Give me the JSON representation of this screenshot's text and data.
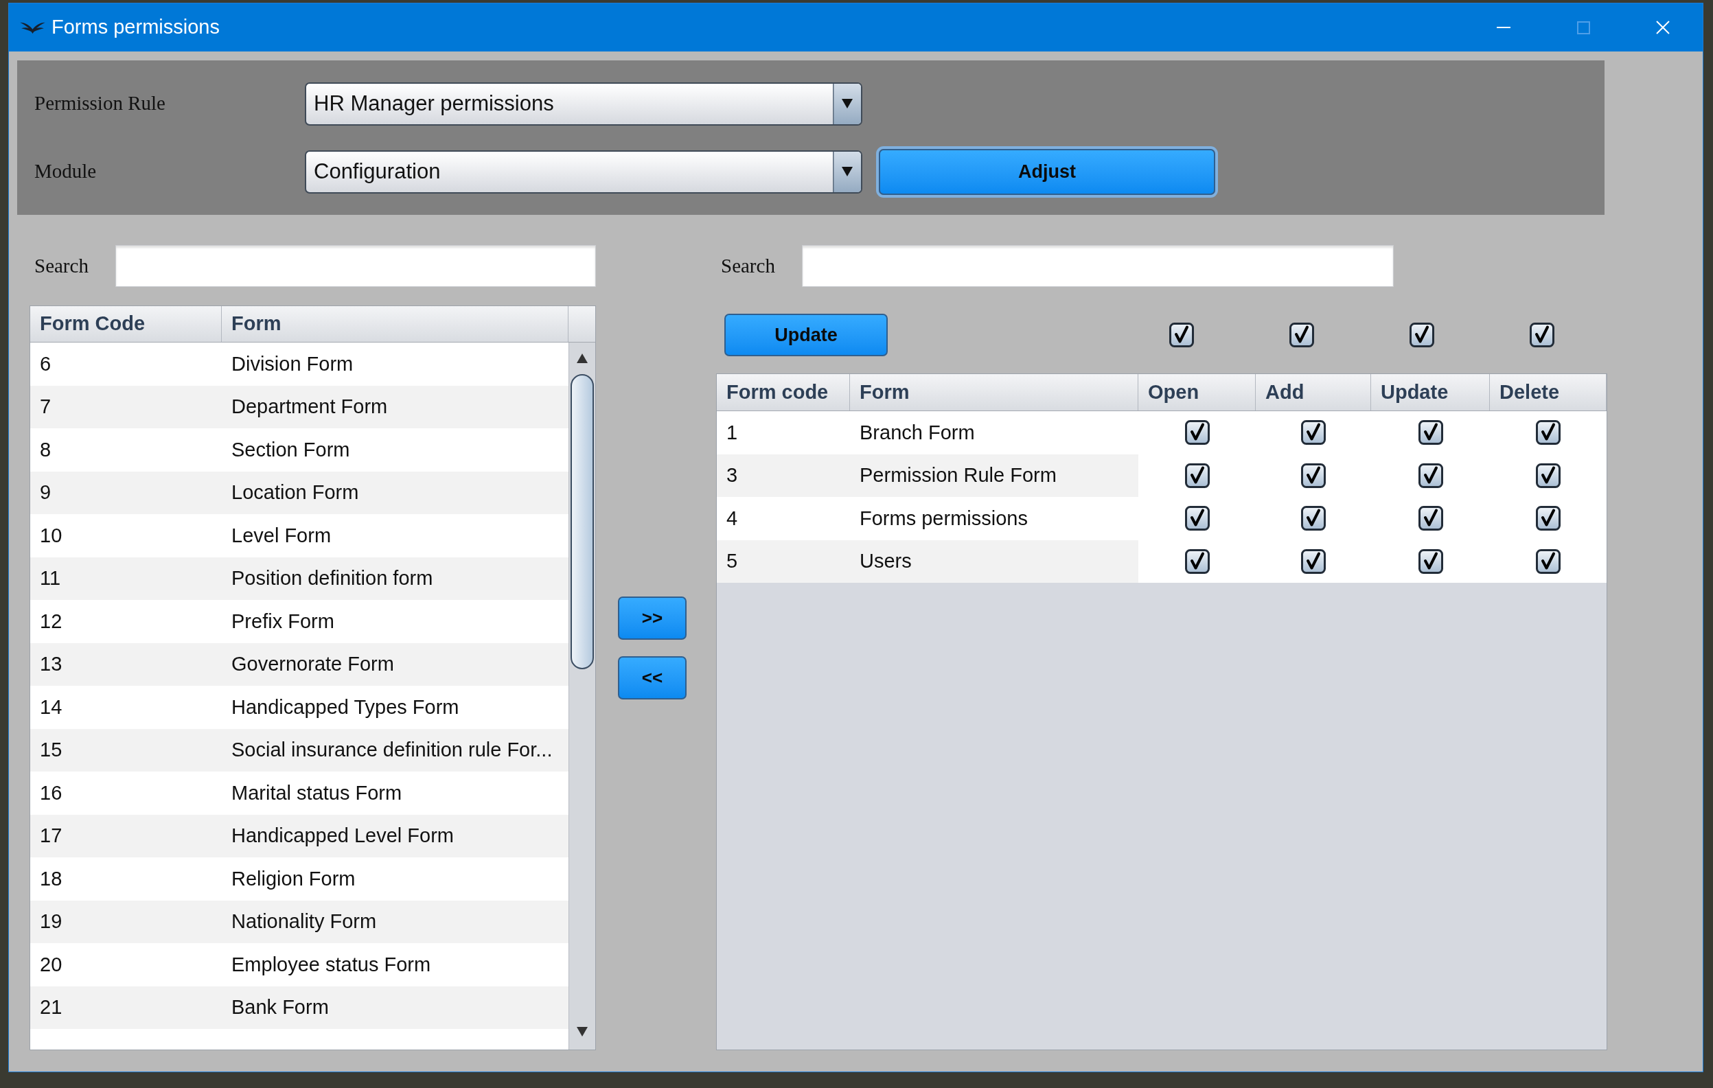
{
  "window": {
    "title": "Forms permissions",
    "controls": [
      {
        "kind": "minimize",
        "disabled": false
      },
      {
        "kind": "maximize",
        "disabled": true
      },
      {
        "kind": "close",
        "disabled": false
      }
    ]
  },
  "filter_panel": {
    "fields": [
      {
        "label": "Permission Rule",
        "value": "HR Manager permissions"
      },
      {
        "label": "Module",
        "value": "Configuration"
      }
    ],
    "adjust_button": {
      "label": "Adjust",
      "focused": true
    }
  },
  "available_forms": {
    "search": {
      "label": "Search"
    },
    "columns": [
      "Form Code",
      "Form"
    ],
    "rows": [
      {
        "code": "6",
        "form": "Division Form"
      },
      {
        "code": "7",
        "form": "Department Form"
      },
      {
        "code": "8",
        "form": "Section Form"
      },
      {
        "code": "9",
        "form": "Location Form"
      },
      {
        "code": "10",
        "form": "Level Form"
      },
      {
        "code": "11",
        "form": "Position definition form"
      },
      {
        "code": "12",
        "form": "Prefix Form"
      },
      {
        "code": "13",
        "form": "Governorate Form"
      },
      {
        "code": "14",
        "form": "Handicapped Types Form"
      },
      {
        "code": "15",
        "form": "Social insurance definition rule For..."
      },
      {
        "code": "16",
        "form": "Marital status Form"
      },
      {
        "code": "17",
        "form": "Handicapped Level Form"
      },
      {
        "code": "18",
        "form": "Religion Form"
      },
      {
        "code": "19",
        "form": "Nationality Form"
      },
      {
        "code": "20",
        "form": "Employee status Form"
      },
      {
        "code": "21",
        "form": "Bank Form"
      }
    ]
  },
  "transfer_buttons": [
    ">>",
    "<<"
  ],
  "assigned_forms": {
    "search": {
      "label": "Search"
    },
    "update_button": "Update",
    "select_all": [
      {
        "checked": true
      },
      {
        "checked": true
      },
      {
        "checked": true
      },
      {
        "checked": true
      }
    ],
    "columns": [
      "Form code",
      "Form",
      "Open",
      "Add",
      "Update",
      "Delete"
    ],
    "rows": [
      {
        "code": "1",
        "form": "Branch Form",
        "permissions": [
          {
            "checked": true
          },
          {
            "checked": true
          },
          {
            "checked": true
          },
          {
            "checked": true
          }
        ]
      },
      {
        "code": "3",
        "form": "Permission Rule Form",
        "permissions": [
          {
            "checked": true
          },
          {
            "checked": true
          },
          {
            "checked": true
          },
          {
            "checked": true
          }
        ]
      },
      {
        "code": "4",
        "form": "Forms permissions",
        "permissions": [
          {
            "checked": true
          },
          {
            "checked": true
          },
          {
            "checked": true
          },
          {
            "checked": true
          }
        ]
      },
      {
        "code": "5",
        "form": "Users",
        "permissions": [
          {
            "checked": true
          },
          {
            "checked": true
          },
          {
            "checked": true
          },
          {
            "checked": true
          }
        ]
      }
    ]
  }
}
